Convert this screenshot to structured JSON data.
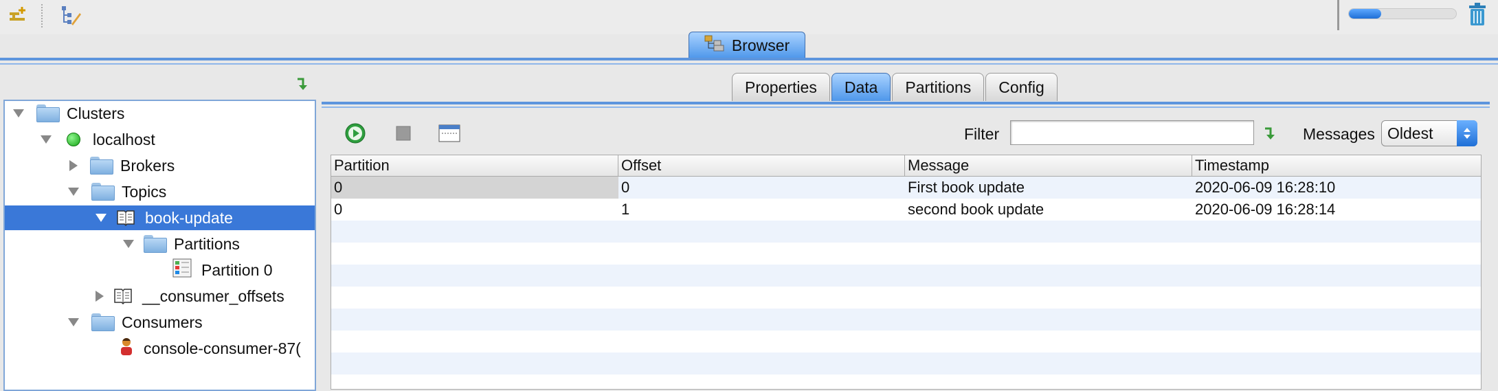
{
  "toolbar": {
    "progress_percent": 30
  },
  "browser_tab": {
    "label": "Browser"
  },
  "tree": {
    "clusters": "Clusters",
    "localhost": "localhost",
    "brokers": "Brokers",
    "topics": "Topics",
    "book_update": "book-update",
    "partitions": "Partitions",
    "partition0": "Partition 0",
    "consumer_offsets": "__consumer_offsets",
    "consumers": "Consumers",
    "console_consumer": "console-consumer-87("
  },
  "tabs": {
    "properties": "Properties",
    "data": "Data",
    "partitions": "Partitions",
    "config": "Config"
  },
  "data_toolbar": {
    "filter_label": "Filter",
    "filter_value": "",
    "messages_label": "Messages",
    "messages_selected": "Oldest"
  },
  "table": {
    "headers": [
      "Partition",
      "Offset",
      "Message",
      "Timestamp"
    ],
    "rows": [
      [
        "0",
        "0",
        "First book update",
        "2020-06-09 16:28:10"
      ],
      [
        "0",
        "1",
        "second book update",
        "2020-06-09 16:28:14"
      ]
    ]
  },
  "colors": {
    "accent": "#3a78d8",
    "tab_active": "#4e97ea",
    "row_stripe": "#edf3fc"
  }
}
